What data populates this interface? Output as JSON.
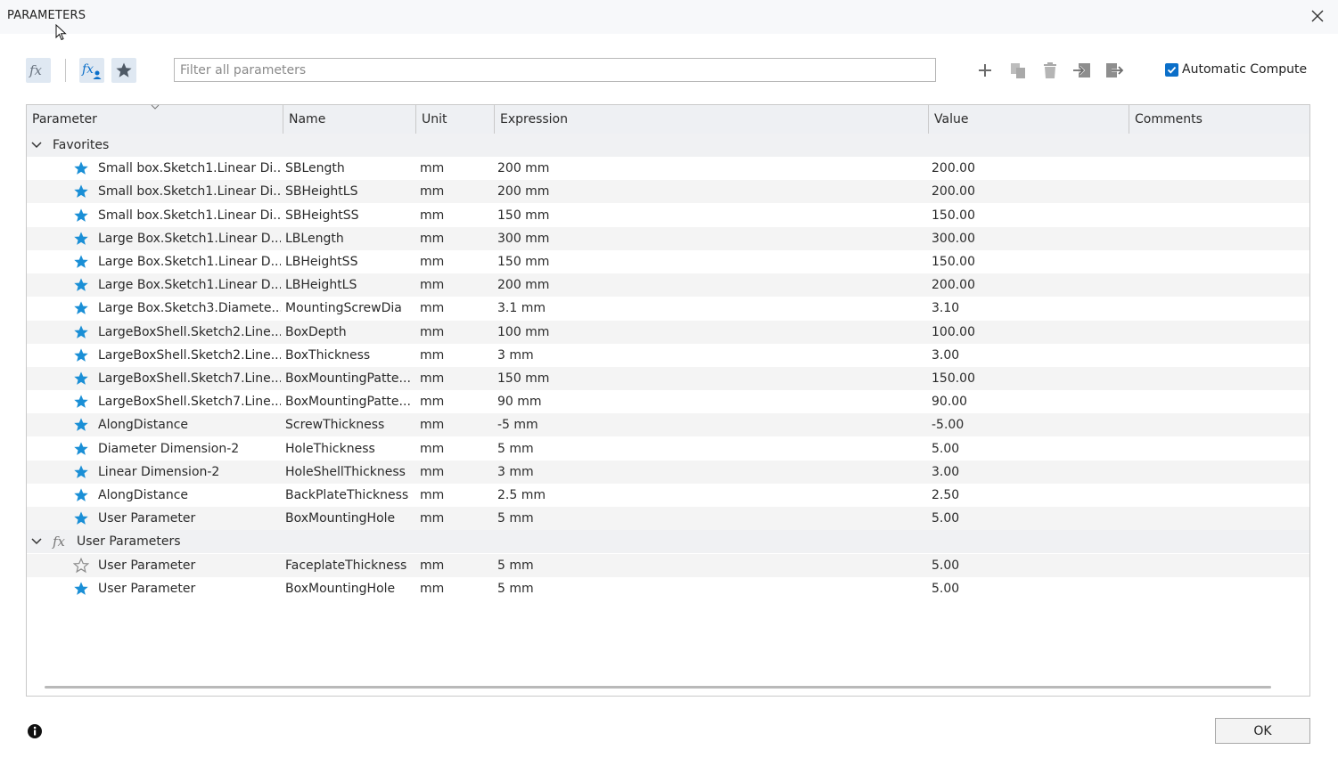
{
  "window": {
    "title": "PARAMETERS"
  },
  "toolbar": {
    "filter_placeholder": "Filter all parameters",
    "filter_value": "",
    "auto_compute_label": "Automatic Compute",
    "auto_compute_checked": true,
    "icons": [
      "fx-icon",
      "fx-user-icon",
      "star-icon",
      "plus-icon",
      "copy-icon",
      "delete-icon",
      "import-icon",
      "export-icon"
    ]
  },
  "columns": {
    "parameter": "Parameter",
    "name": "Name",
    "unit": "Unit",
    "expression": "Expression",
    "value": "Value",
    "comments": "Comments"
  },
  "groups": {
    "favorites": {
      "label": "Favorites",
      "rows": [
        {
          "parameter": "Small box.Sketch1.Linear Di...",
          "name": "SBLength",
          "unit": "mm",
          "expression": "200 mm",
          "value": "200.00",
          "comments": "",
          "favorite": true
        },
        {
          "parameter": "Small box.Sketch1.Linear Di...",
          "name": "SBHeightLS",
          "unit": "mm",
          "expression": "200 mm",
          "value": "200.00",
          "comments": "",
          "favorite": true
        },
        {
          "parameter": "Small box.Sketch1.Linear Di...",
          "name": "SBHeightSS",
          "unit": "mm",
          "expression": "150 mm",
          "value": "150.00",
          "comments": "",
          "favorite": true
        },
        {
          "parameter": "Large Box.Sketch1.Linear D...",
          "name": "LBLength",
          "unit": "mm",
          "expression": "300 mm",
          "value": "300.00",
          "comments": "",
          "favorite": true
        },
        {
          "parameter": "Large Box.Sketch1.Linear D...",
          "name": "LBHeightSS",
          "unit": "mm",
          "expression": "150 mm",
          "value": "150.00",
          "comments": "",
          "favorite": true
        },
        {
          "parameter": "Large Box.Sketch1.Linear D...",
          "name": "LBHeightLS",
          "unit": "mm",
          "expression": "200 mm",
          "value": "200.00",
          "comments": "",
          "favorite": true
        },
        {
          "parameter": "Large Box.Sketch3.Diamete...",
          "name": "MountingScrewDia",
          "unit": "mm",
          "expression": "3.1 mm",
          "value": "3.10",
          "comments": "",
          "favorite": true
        },
        {
          "parameter": "LargeBoxShell.Sketch2.Line...",
          "name": "BoxDepth",
          "unit": "mm",
          "expression": "100 mm",
          "value": "100.00",
          "comments": "",
          "favorite": true
        },
        {
          "parameter": "LargeBoxShell.Sketch2.Line...",
          "name": "BoxThickness",
          "unit": "mm",
          "expression": "3 mm",
          "value": "3.00",
          "comments": "",
          "favorite": true
        },
        {
          "parameter": "LargeBoxShell.Sketch7.Line...",
          "name": "BoxMountingPatte...",
          "unit": "mm",
          "expression": "150 mm",
          "value": "150.00",
          "comments": "",
          "favorite": true
        },
        {
          "parameter": "LargeBoxShell.Sketch7.Line...",
          "name": "BoxMountingPatte...",
          "unit": "mm",
          "expression": "90 mm",
          "value": "90.00",
          "comments": "",
          "favorite": true
        },
        {
          "parameter": "AlongDistance",
          "name": "ScrewThickness",
          "unit": "mm",
          "expression": "-5 mm",
          "value": "-5.00",
          "comments": "",
          "favorite": true
        },
        {
          "parameter": "Diameter Dimension-2",
          "name": "HoleThickness",
          "unit": "mm",
          "expression": "5 mm",
          "value": "5.00",
          "comments": "",
          "favorite": true
        },
        {
          "parameter": "Linear Dimension-2",
          "name": "HoleShellThickness",
          "unit": "mm",
          "expression": "3 mm",
          "value": "3.00",
          "comments": "",
          "favorite": true
        },
        {
          "parameter": "AlongDistance",
          "name": "BackPlateThickness",
          "unit": "mm",
          "expression": "2.5 mm",
          "value": "2.50",
          "comments": "",
          "favorite": true
        },
        {
          "parameter": "User Parameter",
          "name": "BoxMountingHole",
          "unit": "mm",
          "expression": "5 mm",
          "value": "5.00",
          "comments": "",
          "favorite": true
        }
      ]
    },
    "user_parameters": {
      "label": "User Parameters",
      "rows": [
        {
          "parameter": "User Parameter",
          "name": "FaceplateThickness",
          "unit": "mm",
          "expression": "5 mm",
          "value": "5.00",
          "comments": "",
          "favorite": false
        },
        {
          "parameter": "User Parameter",
          "name": "BoxMountingHole",
          "unit": "mm",
          "expression": "5 mm",
          "value": "5.00",
          "comments": "",
          "favorite": true
        }
      ]
    }
  },
  "footer": {
    "ok_label": "OK"
  },
  "colors": {
    "accent": "#0b6fc9",
    "star_fill": "#1a8fd6",
    "header_bg": "#eef0f3",
    "row_alt": "#f4f4f4"
  }
}
